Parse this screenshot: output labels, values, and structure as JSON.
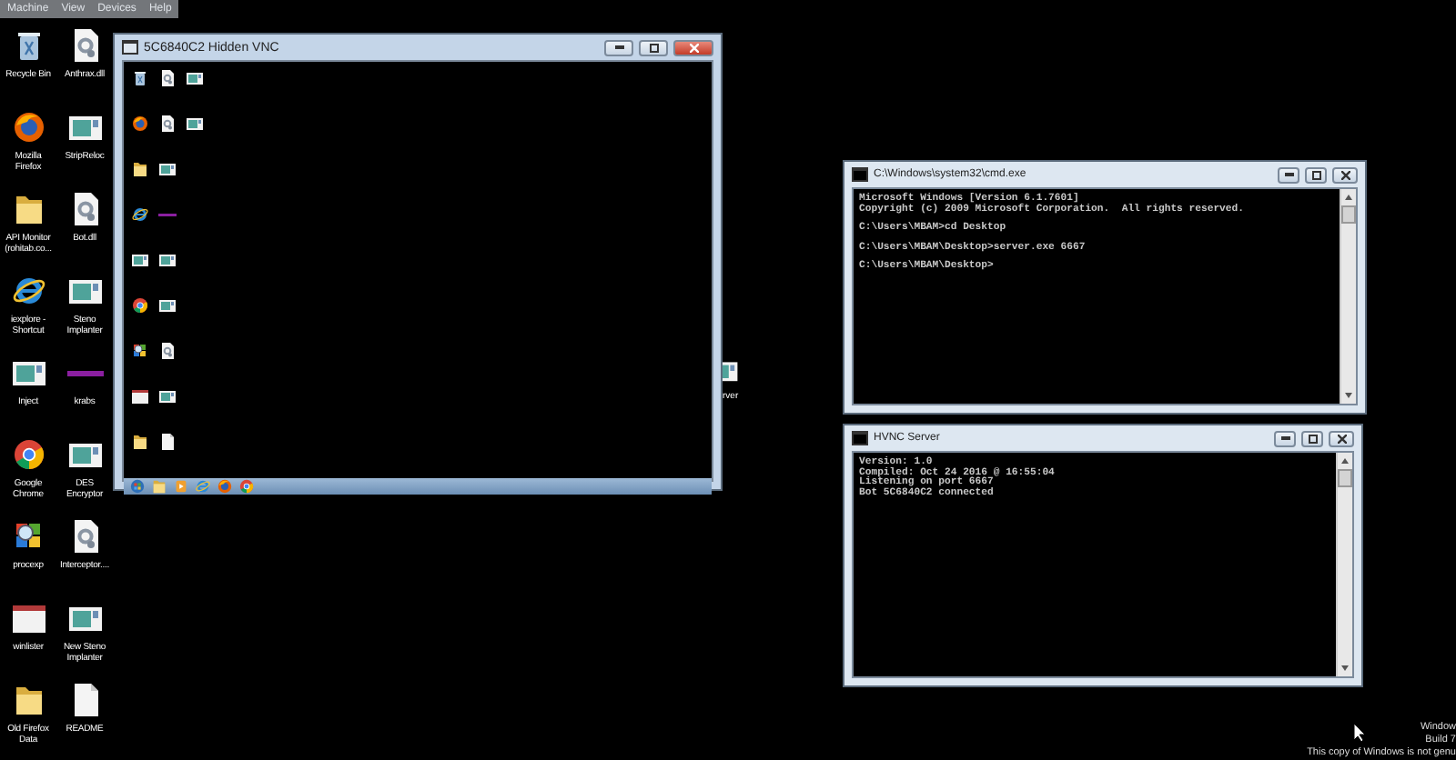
{
  "menu_bar": {
    "items": [
      "Machine",
      "View",
      "Devices",
      "Help"
    ]
  },
  "desktop_icons": [
    {
      "label": "Recycle Bin",
      "kind": "recycle"
    },
    {
      "label": "Anthrax.dll",
      "kind": "dll"
    },
    {
      "label": "Mozilla Firefox",
      "kind": "firefox"
    },
    {
      "label": "StripReloc",
      "kind": "app"
    },
    {
      "label": "API Monitor (rohitab.co...",
      "kind": "folder"
    },
    {
      "label": "Bot.dll",
      "kind": "dll"
    },
    {
      "label": "iexplore - Shortcut",
      "kind": "ie"
    },
    {
      "label": "Steno Implanter",
      "kind": "app"
    },
    {
      "label": "Inject",
      "kind": "app"
    },
    {
      "label": "krabs",
      "kind": "bar"
    },
    {
      "label": "Google Chrome",
      "kind": "chrome"
    },
    {
      "label": "DES Encryptor",
      "kind": "app"
    },
    {
      "label": "procexp",
      "kind": "procexp"
    },
    {
      "label": "Interceptor....",
      "kind": "dll"
    },
    {
      "label": "winlister",
      "kind": "window"
    },
    {
      "label": "New Steno Implanter",
      "kind": "app"
    },
    {
      "label": "Old Firefox Data",
      "kind": "folder"
    },
    {
      "label": "README",
      "kind": "file"
    }
  ],
  "windows": [
    {
      "kind": "vnc",
      "title": "5C6840C2 Hidden VNC",
      "remote_columns": [
        [
          {
            "kind": "recycle"
          },
          {
            "kind": "firefox"
          },
          {
            "kind": "folder"
          },
          {
            "kind": "ie"
          },
          {
            "kind": "app"
          },
          {
            "kind": "chrome"
          },
          {
            "kind": "procexp"
          },
          {
            "kind": "window"
          },
          {
            "kind": "folder"
          }
        ],
        [
          {
            "kind": "dll"
          },
          {
            "kind": "dll"
          },
          {
            "kind": "app"
          },
          {
            "kind": "bar"
          },
          {
            "kind": "app"
          },
          {
            "kind": "app"
          },
          {
            "kind": "dll"
          },
          {
            "kind": "app"
          },
          {
            "kind": "file"
          }
        ],
        [
          {
            "kind": "app"
          },
          {
            "kind": "app"
          }
        ]
      ],
      "taskbar": [
        {
          "kind": "start"
        },
        {
          "kind": "folder"
        },
        {
          "kind": "media"
        },
        {
          "kind": "ie"
        },
        {
          "kind": "firefox"
        },
        {
          "kind": "chrome"
        }
      ]
    },
    {
      "kind": "console",
      "title": "C:\\Windows\\system32\\cmd.exe",
      "blocks": [
        [
          "Microsoft Windows [Version 6.1.7601]",
          "Copyright (c) 2009 Microsoft Corporation.  All rights reserved."
        ],
        [
          "C:\\Users\\MBAM>cd Desktop"
        ],
        [
          "C:\\Users\\MBAM\\Desktop>server.exe 6667"
        ],
        [
          "C:\\Users\\MBAM\\Desktop>"
        ]
      ]
    },
    {
      "kind": "console",
      "title": "HVNC Server",
      "blocks": [
        [
          "Version: 1.0",
          "Compiled: Oct 24 2016 @ 16:55:04",
          "Listening on port 6667",
          "Bot 5C6840C2 connected"
        ]
      ]
    }
  ],
  "partial_icon": {
    "label": "rver",
    "kind": "app"
  },
  "watermark": [
    "Window",
    "Build 7",
    "This copy of Windows is not genu"
  ]
}
